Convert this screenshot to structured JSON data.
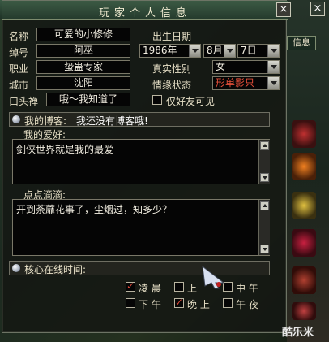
{
  "window": {
    "title": "玩家个人信息",
    "close_label": "×"
  },
  "side": {
    "close_label": "×",
    "tab_label": "信息",
    "watermark": "酷乐米"
  },
  "profile": {
    "name_label": "名称",
    "name_value": "可爱的小修修",
    "id_label": "绰号",
    "id_value": "阿巫",
    "job_label": "职业",
    "job_value": "蛰蛊专家",
    "city_label": "城市",
    "city_value": "沈阳",
    "motto_label": "口头禅",
    "motto_value": "哦～我知道了",
    "birth_label": "出生日期",
    "birth_year": "1986年",
    "birth_month": "8月",
    "birth_day": "7日",
    "gender_label": "真实性别",
    "gender_value": "女",
    "mood_label": "情缘状态",
    "mood_value": "形单影只",
    "friends_only_label": "仅好友可见",
    "friends_only_checked": false
  },
  "blog": {
    "label": "我的博客:",
    "value": "我还没有博客哦!"
  },
  "hobby": {
    "label": "我的爱好:",
    "value": "剑侠世界就是我的最爱"
  },
  "notes": {
    "label": "点点滴滴:",
    "value": "开到荼蘼花事了，尘烟过，知多少？"
  },
  "online": {
    "label": "核心在线时间:",
    "slots": [
      {
        "label": "凌  晨",
        "checked": true
      },
      {
        "label": "上",
        "checked": false
      },
      {
        "label": "中  午",
        "checked": false
      },
      {
        "label": "下  午",
        "checked": false
      },
      {
        "label": "晚  上",
        "checked": true
      },
      {
        "label": "午  夜",
        "checked": false
      }
    ]
  },
  "colors": {
    "accent_red": "#e8503a",
    "title_green": "#3c5a44"
  }
}
